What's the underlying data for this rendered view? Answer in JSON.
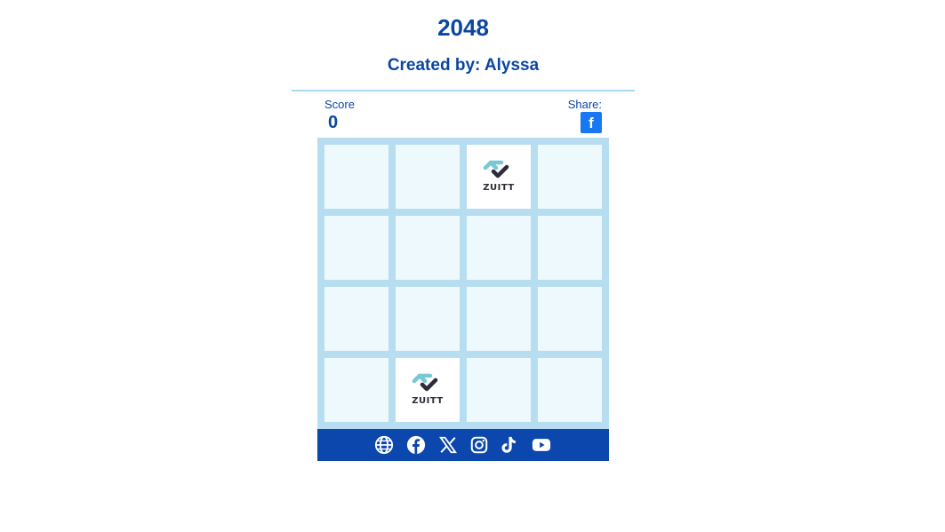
{
  "header": {
    "title": "2048",
    "subtitle": "Created by: Alyssa"
  },
  "scoreboard": {
    "score_label": "Score",
    "score_value": "0",
    "share_label": "Share:",
    "share_icon": "facebook-icon",
    "share_glyph": "f"
  },
  "colors": {
    "primary": "#0b47a1",
    "board_bg": "#b7def0",
    "cell_bg": "#eef9fd",
    "tile_bg": "#ffffff",
    "footer_bg": "#0b47ad",
    "facebook": "#1877f2"
  },
  "board": {
    "size": 4,
    "tiles": [
      {
        "row": 0,
        "col": 2,
        "logo_text": "ZUITT"
      },
      {
        "row": 3,
        "col": 1,
        "logo_text": "ZUITT"
      }
    ]
  },
  "footer": {
    "icons": [
      "globe-icon",
      "facebook-icon",
      "x-icon",
      "instagram-icon",
      "tiktok-icon",
      "youtube-icon"
    ]
  }
}
